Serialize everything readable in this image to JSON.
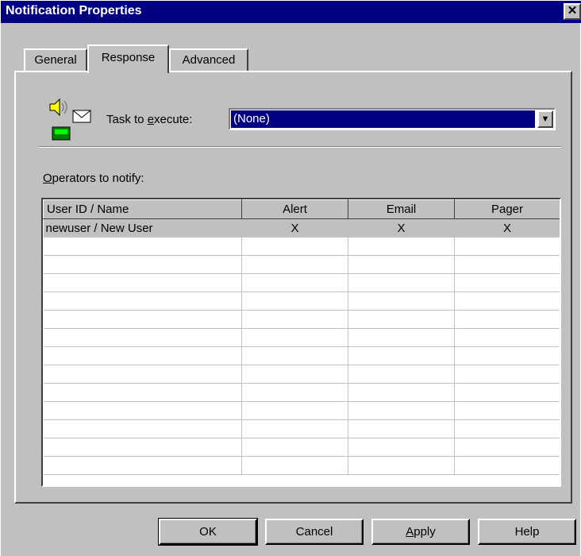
{
  "window": {
    "title": "Notification Properties",
    "close_glyph": "✕"
  },
  "tabs": [
    {
      "label": "General",
      "active": false
    },
    {
      "label": "Response",
      "active": true
    },
    {
      "label": "Advanced",
      "active": false
    }
  ],
  "task": {
    "label_pre": "Task to ",
    "label_key": "e",
    "label_post": "xecute:",
    "value": "(None)",
    "icon": "notification-speaker-mail-icon"
  },
  "operators": {
    "label_key": "O",
    "label_rest": "perators to notify:",
    "columns": [
      "User ID / Name",
      "Alert",
      "Email",
      "Pager"
    ],
    "rows": [
      {
        "user": "newuser / New User",
        "alert": "X",
        "email": "X",
        "pager": "X"
      }
    ]
  },
  "buttons": {
    "ok": "OK",
    "cancel": "Cancel",
    "apply_key": "A",
    "apply_rest": "pply",
    "help": "Help"
  },
  "colors": {
    "titlebar": "#000080",
    "face": "#c0c0c0",
    "selection": "#000080"
  }
}
